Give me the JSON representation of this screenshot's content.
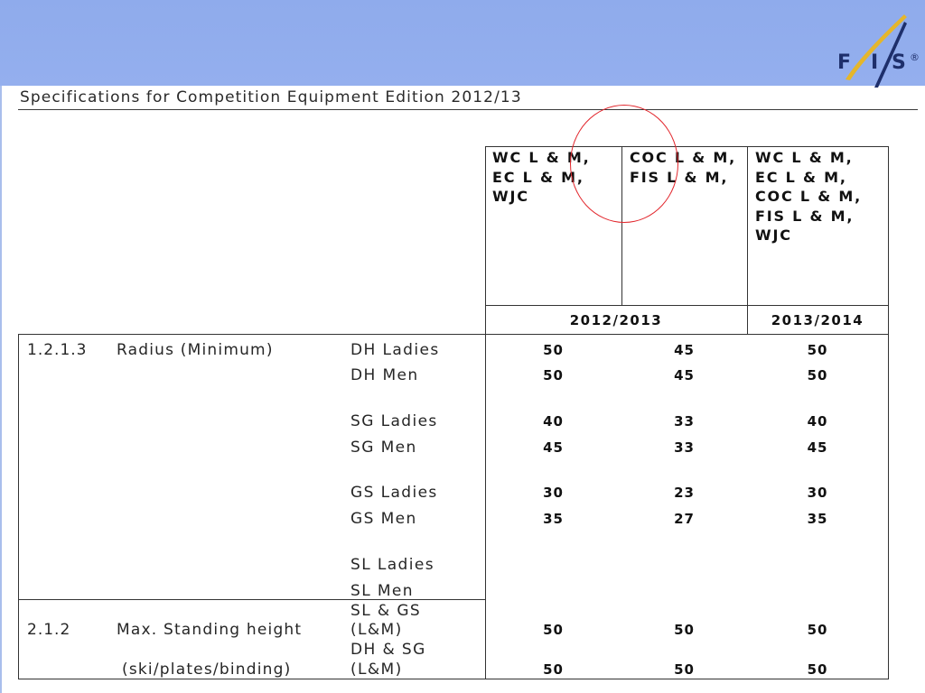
{
  "slide": {
    "title": "Specifications for Competition Equipment Edition 2012/13"
  },
  "logo": {
    "letter_1": "F",
    "letter_2": "I",
    "letter_3": "S",
    "registered": "®"
  },
  "colors": {
    "header_band": "#8FABEC",
    "logo_navy": "#1E2F6B",
    "logo_gold": "#E5B62B",
    "highlight_circle": "#E2262C",
    "table_border": "#333333",
    "text": "#222222"
  },
  "table": {
    "column_headers": [
      [
        "WC L & M,",
        "EC L & M,",
        "WJC"
      ],
      [
        "COC L & M,",
        "FIS L & M,"
      ],
      [
        "WC L & M,",
        "EC L & M,",
        "COC L & M,",
        "FIS L & M,",
        "WJC"
      ]
    ],
    "seasons": [
      "2012/2013",
      "2013/2014"
    ],
    "sections": [
      {
        "number": "1.2.1.3",
        "name": [
          "Radius (Minimum)"
        ],
        "rows": [
          {
            "category": [
              "DH Ladies"
            ],
            "values": [
              "50",
              "45",
              "50"
            ]
          },
          {
            "category": [
              "DH Men"
            ],
            "values": [
              "50",
              "45",
              "50"
            ]
          },
          {
            "category": [
              "SG Ladies"
            ],
            "values": [
              "40",
              "33",
              "40"
            ]
          },
          {
            "category": [
              "SG Men"
            ],
            "values": [
              "45",
              "33",
              "45"
            ]
          },
          {
            "category": [
              "GS Ladies"
            ],
            "values": [
              "30",
              "23",
              "30"
            ]
          },
          {
            "category": [
              "GS Men"
            ],
            "values": [
              "35",
              "27",
              "35"
            ]
          },
          {
            "category": [
              "SL Ladies"
            ],
            "values": []
          },
          {
            "category": [
              "SL Men"
            ],
            "values": []
          }
        ]
      },
      {
        "number": "2.1.2",
        "name": [
          "Max. Standing height",
          "(ski/plates/binding)"
        ],
        "rows": [
          {
            "category": [
              "SL & GS",
              "(L&M)"
            ],
            "values": [
              "50",
              "50",
              "50"
            ]
          },
          {
            "category": [
              "DH & SG",
              "(L&M)"
            ],
            "values": [
              "50",
              "50",
              "50"
            ]
          }
        ]
      }
    ]
  }
}
